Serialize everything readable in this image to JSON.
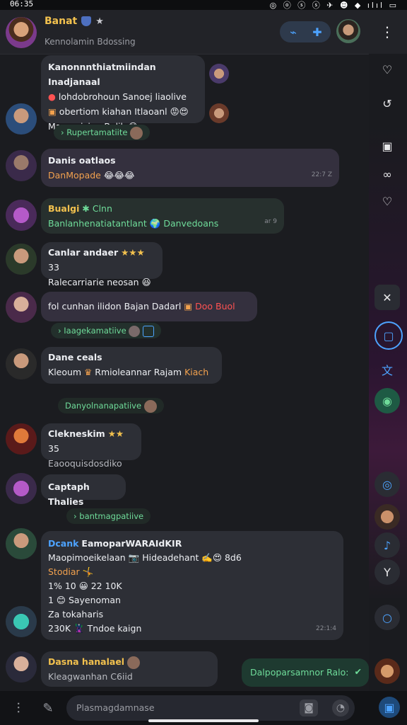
{
  "status": {
    "time": "06:35",
    "icons": "◎ ⓞ ⓢ ⓢ ✈ ☻ ◆ ılıl ▭"
  },
  "header": {
    "title": "Banat",
    "subtitle": "Kennolamin Bdossing",
    "badges": [
      "shield-icon",
      "star-icon"
    ]
  },
  "messages": [
    {
      "sender": "Kanonnnthiatmiindan Inadjanaal",
      "lines": [
        "lohdobrohoun Sanoej liaolive",
        "obertiom kiahan Itlaoanl",
        "Maemaician Balik"
      ]
    },
    {
      "system": "Rupertamatiite"
    },
    {
      "sender": "Danis oatlaos",
      "lines": [
        "DanMopade"
      ],
      "time": "22:7 Z"
    },
    {
      "sender": "Bualgi",
      "sender_extra": "Clnn",
      "lines": [
        "Banlanhenatiatantlant",
        "Danvedoans"
      ],
      "time": "ar 9"
    },
    {
      "sender": "Canlar andaer",
      "sender_extra": "33",
      "lines": [
        "Ralecarriarie neosan"
      ]
    },
    {
      "lines": [
        "fol cunhan ilidon Bajan Dadarl",
        "Doo Buol"
      ]
    },
    {
      "system": "Iaagekamatiive"
    },
    {
      "sender": "Dane ceals",
      "lines": [
        "Kleoum",
        "Rmioleannar Rajam",
        "Kiach"
      ]
    },
    {
      "system": "Danyolnanapatiive"
    },
    {
      "sender": "Clekneskim",
      "sender_extra": "35",
      "lines": [
        "Eaooquisdosdiko"
      ]
    },
    {
      "sender": "Captaph Thalies",
      "lines": []
    },
    {
      "system": "bantmagpatiive"
    },
    {
      "sender": "Dcank",
      "sender_extra": "EamoparWARAIdKIR",
      "lines": [
        "Maopimoeikelaan",
        "Hideadehant",
        "8d6",
        "Stodiar",
        "1%",
        "10",
        "22 10K",
        "1",
        "Sayenoman",
        "Za tokaharis",
        "230K",
        "Tndoe kaign"
      ],
      "time": "22:1:4"
    },
    {
      "sender": "Dasna hanalael",
      "lines": [
        "Kleagwanhan C6iid"
      ]
    },
    {
      "outgoing": "Dalpoparsamnor Ralo:"
    }
  ],
  "composer": {
    "placeholder": "Plasmagdamnase"
  },
  "colors": {
    "accent_yellow": "#f2c14e",
    "accent_green": "#6fdc9a",
    "accent_blue": "#4da3ff",
    "accent_red": "#ff5252",
    "bg": "#1b1c20"
  }
}
